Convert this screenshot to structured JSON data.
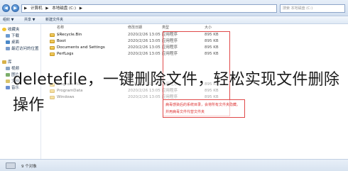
{
  "window": {
    "address_parts": [
      "▶",
      "计算机",
      "▶",
      "本地磁盘 (C:)",
      "▶"
    ],
    "search_placeholder": "搜索 本地磁盘 (C:)",
    "back_glyph": "◀",
    "forward_glyph": "▶"
  },
  "toolbar": {
    "organize": "组织 ▼",
    "share": "共享 ▼",
    "new_folder": "新建文件夹"
  },
  "sidebar": {
    "items": [
      {
        "label": "收藏夹",
        "icon": "star-icon",
        "color": "#f2c230"
      },
      {
        "label": "下载",
        "icon": "download-folder-icon",
        "color": "#6b9bd2"
      },
      {
        "label": "桌面",
        "icon": "desktop-icon",
        "color": "#4a88c9"
      },
      {
        "label": "最近访问的位置",
        "icon": "recent-places-icon",
        "color": "#7a9ccc"
      },
      {
        "label": "库",
        "icon": "library-icon",
        "color": "#d9b24a"
      },
      {
        "label": "视频",
        "icon": "video-icon",
        "color": "#8aa4c4"
      },
      {
        "label": "图片",
        "icon": "pictures-icon",
        "color": "#7cae6a"
      },
      {
        "label": "文档",
        "icon": "documents-icon",
        "color": "#d9c36a"
      },
      {
        "label": "音乐",
        "icon": "music-icon",
        "color": "#6a8fd2"
      }
    ]
  },
  "columns": {
    "name": "名称",
    "date": "修改日期",
    "type": "类型",
    "size": "大小"
  },
  "files": [
    {
      "name": "$Recycle.Bin",
      "date": "2020/2/26 13:05",
      "type": "应用程序",
      "size": "895 KB"
    },
    {
      "name": "Boot",
      "date": "2020/2/26 13:05",
      "type": "应用程序",
      "size": "895 KB"
    },
    {
      "name": "Documents and Settings",
      "date": "2020/2/26 13:05",
      "type": "应用程序",
      "size": "895 KB"
    },
    {
      "name": "PerfLogs",
      "date": "2020/2/26 13:05",
      "type": "应用程序",
      "size": "895 KB"
    },
    {
      "name": "Program Files",
      "date": "2020/2/26 13:05",
      "type": "应用程序",
      "size": "895 KB"
    },
    {
      "name": "ProgramData",
      "date": "2020/2/26 13:05",
      "type": "应用程序",
      "size": "895 KB"
    },
    {
      "name": "Windows",
      "date": "2020/2/26 13:05",
      "type": "应用程序",
      "size": "895 KB"
    }
  ],
  "annotation": {
    "line1": "病毒感染后的系统目录，会将所有文件夹隐藏。",
    "line2": "并用病毒文件代替文件夹"
  },
  "overlay_text": "deletefile，一键删除文件，轻松实现文件删除操作",
  "status": {
    "text": "9 个对象"
  },
  "colors": {
    "highlight_box": "#e04a4a",
    "folder": "#f0c850"
  }
}
